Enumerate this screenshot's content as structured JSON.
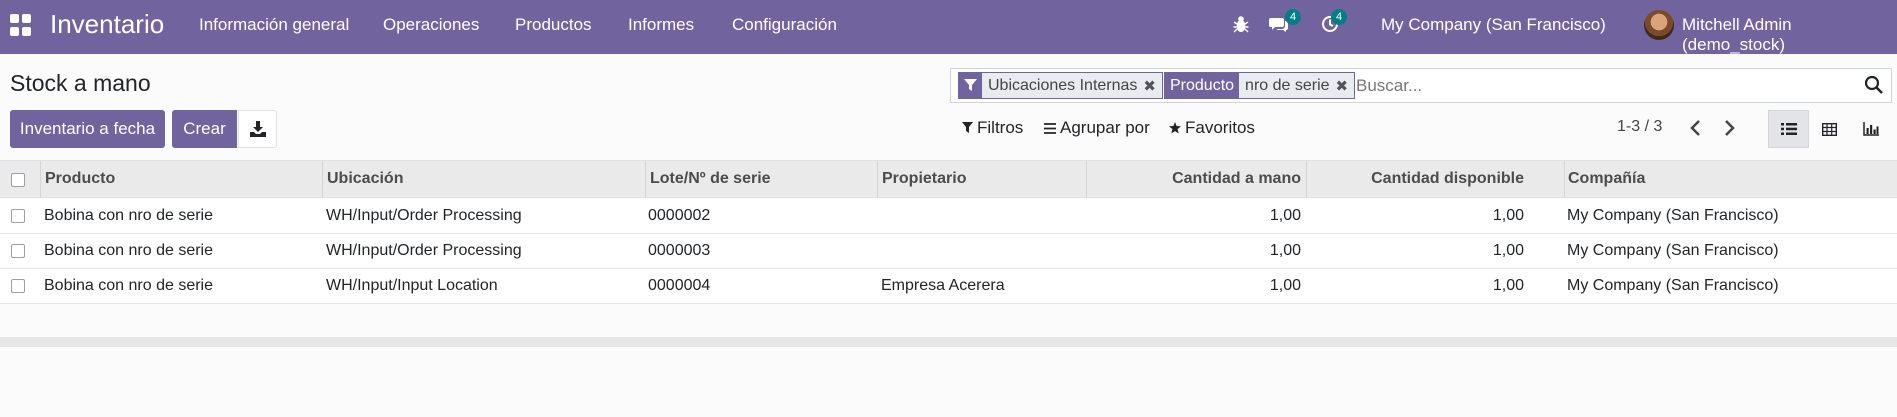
{
  "navbar": {
    "app_name": "Inventario",
    "menu": [
      "Información general",
      "Operaciones",
      "Productos",
      "Informes",
      "Configuración"
    ],
    "messages_count": "4",
    "activities_count": "4",
    "company": "My Company (San Francisco)",
    "user": "Mitchell Admin (demo_stock)"
  },
  "page": {
    "title": "Stock a mano",
    "buttons": {
      "inventory_at_date": "Inventario a fecha",
      "create": "Crear"
    }
  },
  "search": {
    "facets": [
      {
        "type": "filter",
        "values": "Ubicaciones Internas"
      },
      {
        "type": "field",
        "label": "Producto",
        "values": "nro de serie"
      }
    ],
    "placeholder": "Buscar..."
  },
  "filters": {
    "filters_label": "Filtros",
    "group_by_label": "Agrupar por",
    "favorites_label": "Favoritos"
  },
  "pager": {
    "value": "1-3 / 3"
  },
  "table": {
    "columns": [
      "Producto",
      "Ubicación",
      "Lote/Nº de serie",
      "Propietario",
      "Cantidad a mano",
      "Cantidad disponible",
      "Compañía"
    ],
    "rows": [
      {
        "product": "Bobina con nro de serie",
        "location": "WH/Input/Order Processing",
        "lot": "0000002",
        "owner": "",
        "on_hand": "1,00",
        "available": "1,00",
        "company": "My Company (San Francisco)"
      },
      {
        "product": "Bobina con nro de serie",
        "location": "WH/Input/Order Processing",
        "lot": "0000003",
        "owner": "",
        "on_hand": "1,00",
        "available": "1,00",
        "company": "My Company (San Francisco)"
      },
      {
        "product": "Bobina con nro de serie",
        "location": "WH/Input/Input Location",
        "lot": "0000004",
        "owner": "Empresa Acerera",
        "on_hand": "1,00",
        "available": "1,00",
        "company": "My Company (San Francisco)"
      }
    ]
  },
  "colors": {
    "brand": "#71639e",
    "badge": "#017e84"
  }
}
